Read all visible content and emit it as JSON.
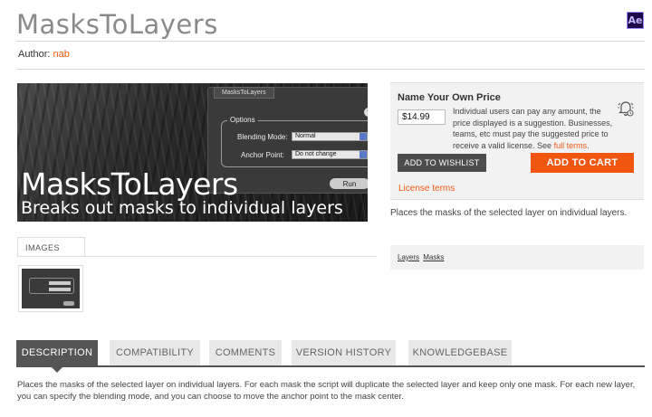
{
  "header": {
    "title": "MasksToLayers",
    "app_badge": "Ae",
    "author_label": "Author:",
    "author_name": "nab"
  },
  "banner": {
    "panel_tab": "MasksToLayers",
    "help_glyph": "?",
    "options_label": "Options",
    "blending_label": "Blending Mode:",
    "blending_value": "Normal",
    "anchor_label": "Anchor Point:",
    "anchor_value": "Do not change",
    "run_label": "Run",
    "headline": "MasksToLayers",
    "subline": "Breaks out masks to individual layers"
  },
  "images": {
    "tab_label": "IMAGES"
  },
  "pricing": {
    "title": "Name Your Own Price",
    "price_value": "$14.99",
    "desc_text": "Individual users can pay any amount, the price displayed is a suggestion. Businesses, teams, etc must pay the suggested price to receive a valid license. See ",
    "terms_link": "full terms",
    "desc_end": ".",
    "wishlist_label": "ADD TO WISHLIST",
    "cart_label": "ADD TO CART",
    "license_link": "License terms",
    "accent_color": "#f0560f"
  },
  "summary": "Places the masks of the selected layer on individual layers.",
  "tags": [
    "Layers",
    "Masks"
  ],
  "tabs": [
    {
      "label": "DESCRIPTION",
      "active": true
    },
    {
      "label": "COMPATIBILITY",
      "active": false
    },
    {
      "label": "COMMENTS",
      "active": false
    },
    {
      "label": "VERSION HISTORY",
      "active": false
    },
    {
      "label": "KNOWLEDGEBASE",
      "active": false
    }
  ],
  "description": "Places the masks of the selected layer on individual layers. For each mask the script will duplicate the selected layer and keep only one mask. For each new layer, you can specify the blending mode, and you can choose to move the anchor point to the mask center."
}
